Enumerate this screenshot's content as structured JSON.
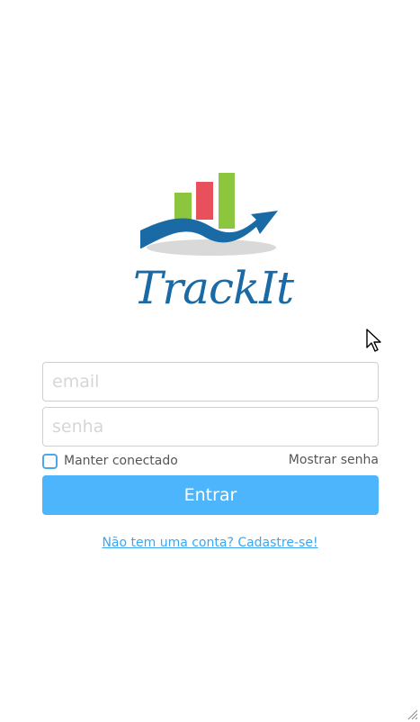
{
  "brand": {
    "name": "TrackIt",
    "colors": {
      "primary_blue": "#1a6aa5",
      "bar_green": "#8cc63f",
      "bar_red": "#e8505b",
      "shadow_gray": "#d9d9d9"
    }
  },
  "form": {
    "email_placeholder": "email",
    "password_placeholder": "senha",
    "remember_label": "Manter conectado",
    "show_password_label": "Mostrar senha",
    "submit_label": "Entrar",
    "signup_link": "Não tem uma conta? Cadastre-se!"
  },
  "colors": {
    "button_bg": "#4db5fb",
    "link": "#3aa6ef",
    "checkbox_border": "#4da7e9"
  },
  "icons": {
    "cursor": "mouse-pointer-icon",
    "resize": "resize-grip-icon"
  }
}
